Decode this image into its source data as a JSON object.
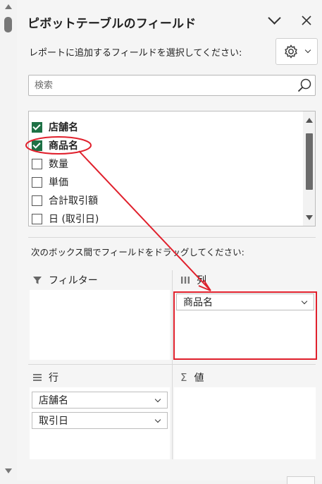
{
  "panel": {
    "title": "ピボットテーブルのフィールド",
    "instruction_select": "レポートに追加するフィールドを選択してください:",
    "instruction_drag": "次のボックス間でフィールドをドラッグしてください:"
  },
  "search": {
    "placeholder": "検索"
  },
  "fields": [
    {
      "label": "店舗名",
      "checked": true
    },
    {
      "label": "商品名",
      "checked": true
    },
    {
      "label": "数量",
      "checked": false
    },
    {
      "label": "単価",
      "checked": false
    },
    {
      "label": "合計取引額",
      "checked": false
    },
    {
      "label": "日 (取引日)",
      "checked": false
    }
  ],
  "areas": {
    "filters": {
      "label": "フィルター",
      "items": []
    },
    "columns": {
      "label": "列",
      "items": [
        "商品名"
      ]
    },
    "rows": {
      "label": "行",
      "items": [
        "店舗名",
        "取引日"
      ]
    },
    "values": {
      "label": "値",
      "items": []
    }
  },
  "annotation": {
    "color": "#e0202c"
  }
}
